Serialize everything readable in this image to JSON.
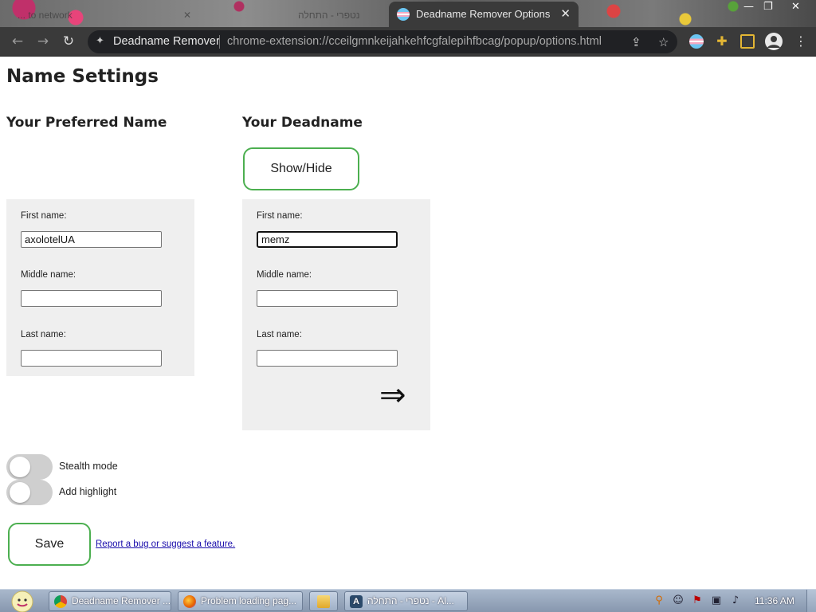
{
  "browser": {
    "background_tab_1": "... to network",
    "background_tab_2": "נטפרי - התחלה",
    "active_tab_title": "Deadname Remover Options",
    "site_name": "Deadname Remover",
    "url": "chrome-extension://cceilgmnkeijahkehfcgfalepihfbcag/popup/options.html"
  },
  "page": {
    "title": "Name Settings",
    "preferred": {
      "heading": "Your Preferred Name",
      "first_label": "First name:",
      "first_value": "axolotelUA",
      "middle_label": "Middle name:",
      "middle_value": "",
      "last_label": "Last name:",
      "last_value": ""
    },
    "deadname": {
      "heading": "Your Deadname",
      "show_hide_label": "Show/Hide",
      "first_label": "First name:",
      "first_value": "memz",
      "middle_label": "Middle name:",
      "middle_value": "",
      "last_label": "Last name:",
      "last_value": "",
      "arrow": "⇒"
    },
    "toggles": [
      {
        "label": "Stealth mode",
        "on": false
      },
      {
        "label": "Add highlight",
        "on": false
      }
    ],
    "save_label": "Save",
    "report_link": "Report a bug or suggest a feature."
  },
  "taskbar": {
    "buttons": [
      {
        "label": "Deadname Remover ...",
        "icon": "chrome-icon"
      },
      {
        "label": "Problem loading pag...",
        "icon": "firefox-icon"
      },
      {
        "label": "",
        "icon": "folder-icon"
      },
      {
        "label": "נטפרי - התחלה - Al...",
        "icon": "app-a-icon"
      }
    ],
    "clock": "11:36 AM"
  },
  "colors": {
    "accent_green": "#4caf50",
    "chrome_dark": "#3a3a3a",
    "card_bg": "#efefef",
    "link": "#1a0dab"
  }
}
